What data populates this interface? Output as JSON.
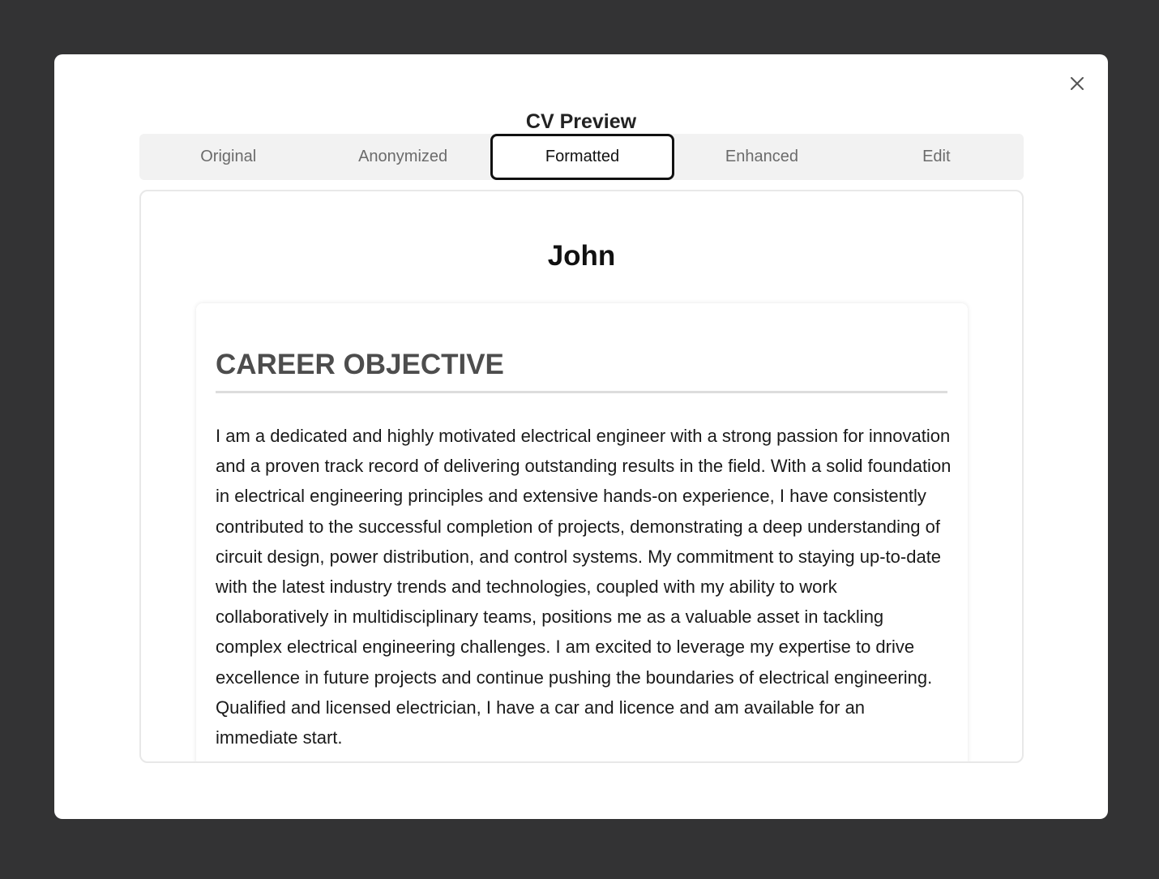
{
  "modal": {
    "title": "CV Preview",
    "close_icon": "close-icon"
  },
  "tabs": [
    {
      "label": "Original",
      "active": false
    },
    {
      "label": "Anonymized",
      "active": false
    },
    {
      "label": "Formatted",
      "active": true
    },
    {
      "label": "Enhanced",
      "active": false
    },
    {
      "label": "Edit",
      "active": false
    }
  ],
  "cv": {
    "name": "John",
    "sections": [
      {
        "heading": "CAREER OBJECTIVE",
        "body": "I am a dedicated and highly motivated electrical engineer with a strong passion for innovation and a proven track record of delivering outstanding results in the field. With a solid foundation in electrical engineering principles and extensive hands-on experience, I have consistently contributed to the successful completion of projects, demonstrating a deep understanding of circuit design, power distribution, and control systems. My commitment to staying up-to-date with the latest industry trends and technologies, coupled with my ability to work collaboratively in multidisciplinary teams, positions me as a valuable asset in tackling complex electrical engineering challenges. I am excited to leverage my expertise to drive excellence in future projects and continue pushing the boundaries of electrical engineering. Qualified and licensed electrician, I have a car and licence and am available for an immediate start."
      }
    ]
  }
}
